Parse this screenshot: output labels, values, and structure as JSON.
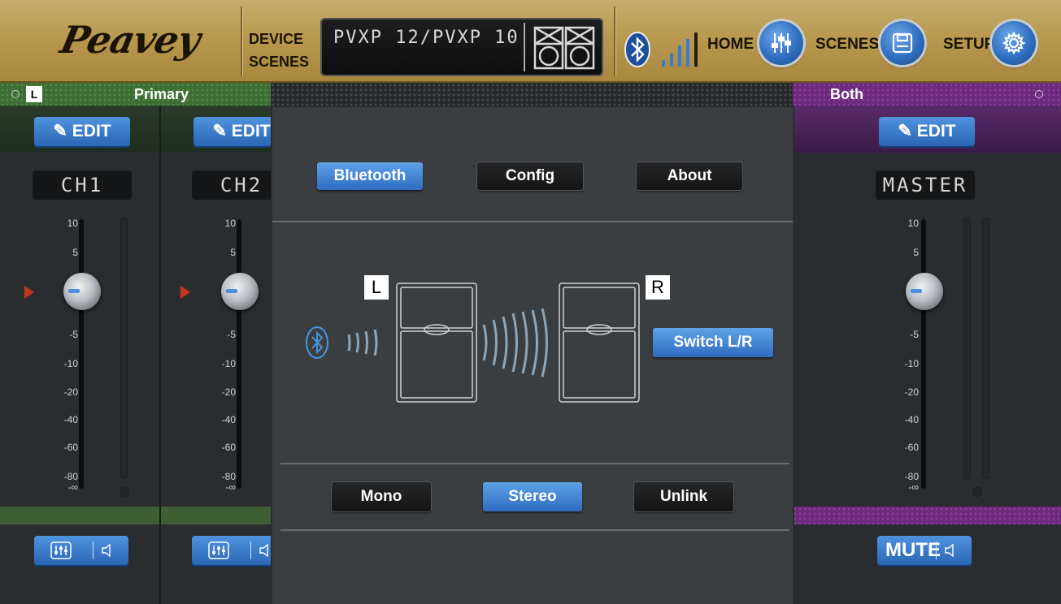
{
  "brand": {
    "logo_text": "Peavey"
  },
  "header": {
    "device_label_line1": "DEVICE",
    "device_label_line2": "SCENES",
    "device_name": "PVXP 12/PVXP 10",
    "nav": [
      {
        "label": "HOME",
        "icon": "mixer-sliders-icon"
      },
      {
        "label": "SCENES",
        "icon": "floppy-disk-icon"
      },
      {
        "label": "SETUP",
        "icon": "gear-icon"
      }
    ],
    "status_icons": [
      "bluetooth-icon",
      "signal-strength-icon"
    ]
  },
  "groups": {
    "left": {
      "tag": "L",
      "label": "Primary",
      "color": "#3e6d33"
    },
    "right": {
      "label": "Both",
      "color": "#6b2a7a"
    }
  },
  "channels": [
    {
      "name": "CH1",
      "edit_label": "EDIT",
      "fader_db": 0
    },
    {
      "name": "CH2",
      "edit_label": "EDIT",
      "fader_db": 0
    }
  ],
  "master": {
    "name": "MASTER",
    "edit_label": "EDIT",
    "mute_label": "MUTE",
    "fader_db": 0
  },
  "fader_scale": [
    "10",
    "5",
    "0",
    "-5",
    "-10",
    "-20",
    "-40",
    "-60",
    "-80",
    "-∞"
  ],
  "panel": {
    "tabs": [
      {
        "label": "Bluetooth",
        "active": true
      },
      {
        "label": "Config",
        "active": false
      },
      {
        "label": "About",
        "active": false
      }
    ],
    "left_tag": "L",
    "right_tag": "R",
    "switch_label": "Switch L/R",
    "modes": [
      {
        "label": "Mono",
        "active": false
      },
      {
        "label": "Stereo",
        "active": true
      },
      {
        "label": "Unlink",
        "active": false
      }
    ]
  },
  "colors": {
    "accent_blue": "#2e6cc0",
    "gold": "#b8994f",
    "red_marker": "#c6341e"
  }
}
